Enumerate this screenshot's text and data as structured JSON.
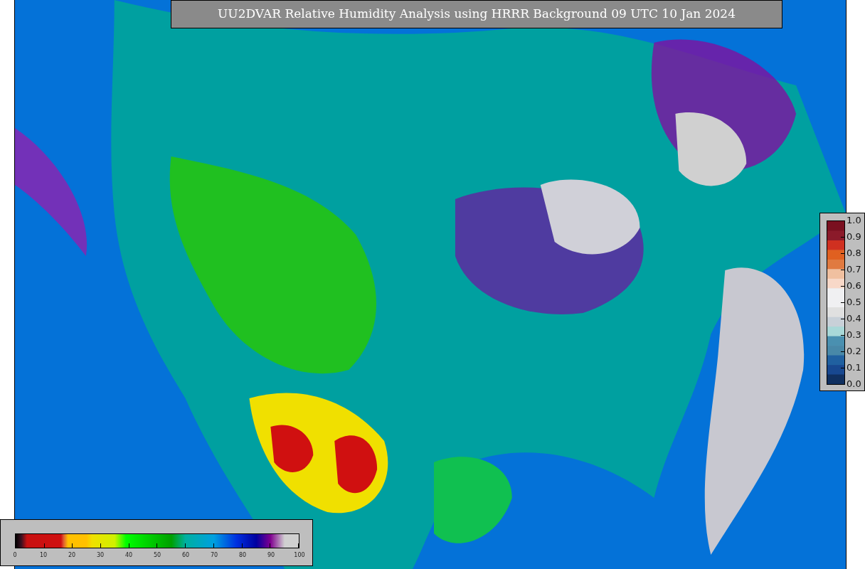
{
  "title": "UU2DVAR Relative Humidity Analysis using HRRR Background 09 UTC 10 Jan 2024",
  "humidity_legend": {
    "ticks": [
      "0",
      "10",
      "20",
      "30",
      "40",
      "50",
      "60",
      "70",
      "80",
      "90",
      "100"
    ]
  },
  "scale_legend": {
    "ticks": [
      "1.0",
      "0.9",
      "0.8",
      "0.7",
      "0.6",
      "0.5",
      "0.4",
      "0.3",
      "0.2",
      "0.1",
      "0.0"
    ]
  }
}
